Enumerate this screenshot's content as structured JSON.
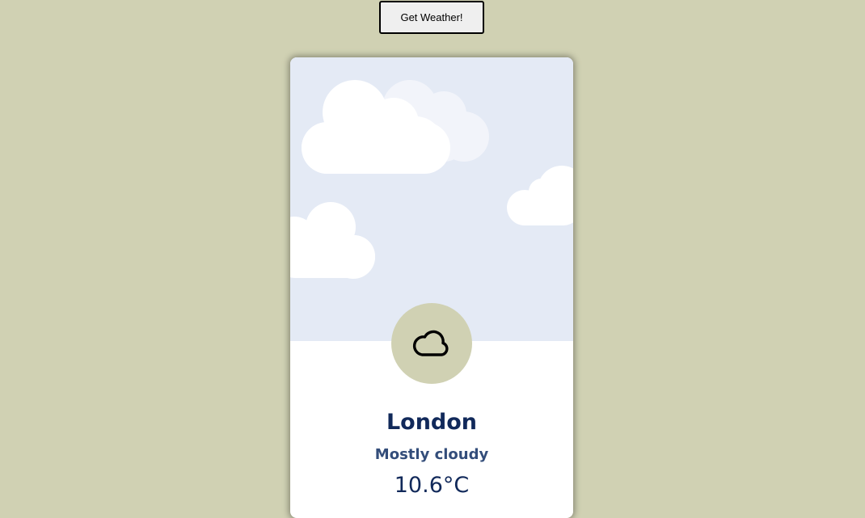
{
  "toolbar": {
    "get_weather_label": "Get Weather!"
  },
  "weather": {
    "city": "London",
    "condition": "Mostly cloudy",
    "temperature": "10.6°C",
    "icon": "cloud-icon"
  },
  "colors": {
    "page_background": "#d0d1b3",
    "sky": "#e4eaf5",
    "icon_circle": "#d0d1b3",
    "city_text": "#11295a",
    "condition_text": "#334d7a"
  }
}
